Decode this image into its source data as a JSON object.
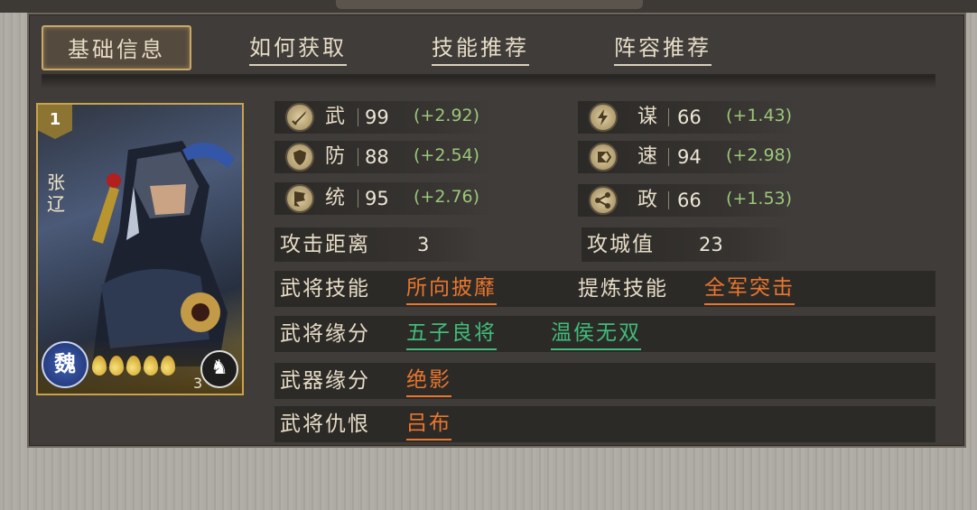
{
  "tabs": [
    {
      "label": "基础信息",
      "active": true
    },
    {
      "label": "如何获取",
      "active": false
    },
    {
      "label": "技能推荐",
      "active": false
    },
    {
      "label": "阵容推荐",
      "active": false
    }
  ],
  "card": {
    "level": "1",
    "name": "张\n辽",
    "faction": "魏",
    "stars": 5,
    "count": "3"
  },
  "stats": [
    {
      "label": "武",
      "value": "99",
      "growth": "(+2.92)",
      "icon": "sword-icon"
    },
    {
      "label": "谋",
      "value": "66",
      "growth": "(+1.43)",
      "icon": "lightning-icon"
    },
    {
      "label": "防",
      "value": "88",
      "growth": "(+2.54)",
      "icon": "shield-icon"
    },
    {
      "label": "速",
      "value": "94",
      "growth": "(+2.98)",
      "icon": "speed-icon"
    },
    {
      "label": "统",
      "value": "95",
      "growth": "(+2.76)",
      "icon": "flag-icon"
    },
    {
      "label": "政",
      "value": "66",
      "growth": "(+1.53)",
      "icon": "network-icon"
    }
  ],
  "misc": {
    "range_label": "攻击距离",
    "range_value": "3",
    "siege_label": "攻城值",
    "siege_value": "23"
  },
  "rows": {
    "skill_label": "武将技能",
    "skill_value": "所向披靡",
    "refine_label": "提炼技能",
    "refine_value": "全军突击",
    "bond_label": "武将缘分",
    "bond_values": [
      "五子良将",
      "温侯无双"
    ],
    "weapon_label": "武器缘分",
    "weapon_value": "绝影",
    "enemy_label": "武将仇恨",
    "enemy_value": "吕布"
  },
  "colors": {
    "link_orange": "#e9762e",
    "link_green": "#3fbd7a",
    "growth_green": "#9bc87a",
    "gold": "#c9a96a"
  }
}
